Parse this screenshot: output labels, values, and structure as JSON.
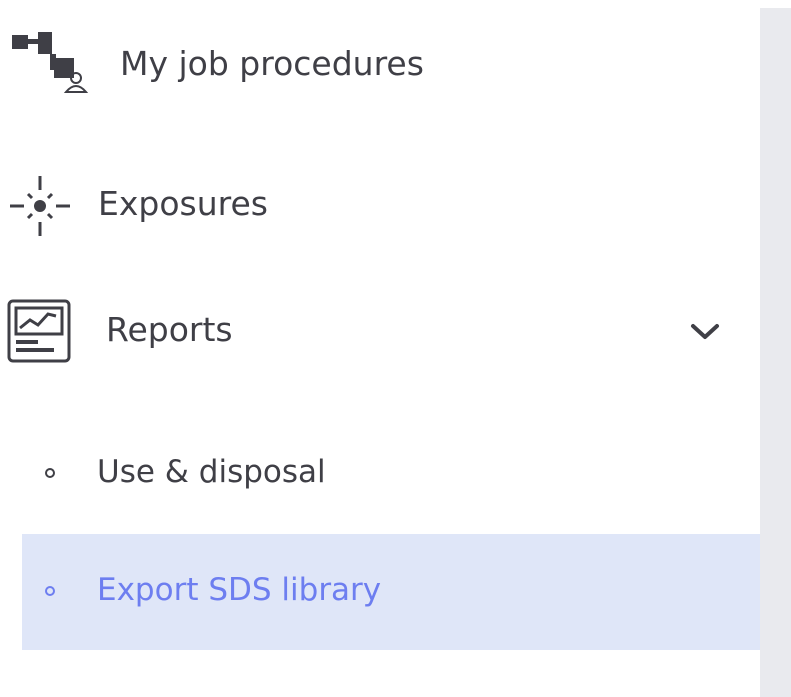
{
  "sidebar": {
    "items": [
      {
        "label": "My job procedures",
        "icon": "job-procedures-icon"
      },
      {
        "label": "Exposures",
        "icon": "exposures-icon"
      },
      {
        "label": "Reports",
        "icon": "reports-icon",
        "expanded": true
      }
    ],
    "reports_submenu": [
      {
        "label": "Use & disposal",
        "active": false
      },
      {
        "label": "Export SDS library",
        "active": true
      }
    ]
  },
  "colors": {
    "text": "#3f3f46",
    "active_text": "#6d7ef0",
    "active_bg": "#dfe6f8",
    "panel_bg": "#e9eaee"
  }
}
